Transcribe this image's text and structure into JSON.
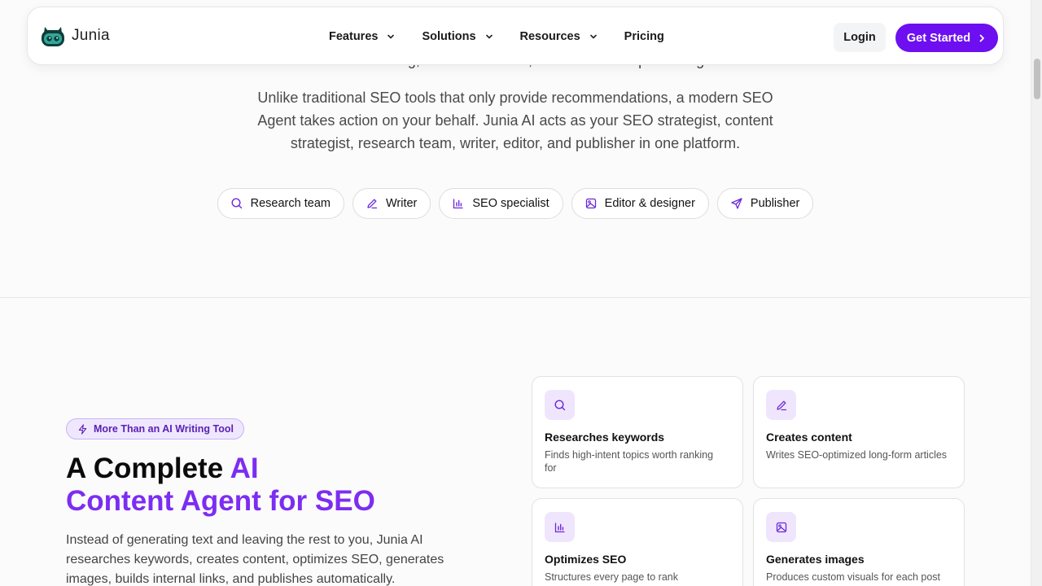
{
  "header": {
    "brand": "Junia",
    "nav": [
      {
        "label": "Features",
        "has_dropdown": true
      },
      {
        "label": "Solutions",
        "has_dropdown": true
      },
      {
        "label": "Resources",
        "has_dropdown": true
      },
      {
        "label": "Pricing",
        "has_dropdown": false
      }
    ],
    "login_label": "Login",
    "cta_label": "Get Started"
  },
  "top_fragment": {
    "line1": "",
    "line2": "internal linking, content creation, and automated publishing."
  },
  "intro": {
    "text": "Unlike traditional SEO tools that only provide recommendations, a modern SEO Agent takes action on your behalf. Junia AI acts as your SEO strategist, content strategist, research team, writer, editor, and publisher in one platform."
  },
  "roles": [
    {
      "label": "Research team",
      "icon": "search-icon"
    },
    {
      "label": "Writer",
      "icon": "pen-icon"
    },
    {
      "label": "SEO specialist",
      "icon": "bar-chart-icon"
    },
    {
      "label": "Editor & designer",
      "icon": "image-icon"
    },
    {
      "label": "Publisher",
      "icon": "send-icon"
    }
  ],
  "section": {
    "badge": "More Than an AI Writing Tool",
    "headline_plain": "A Complete ",
    "headline_accent_1": "AI",
    "headline_accent_2": "Content Agent for SEO",
    "description": "Instead of generating text and leaving the rest to you, Junia AI researches keywords, creates content, optimizes SEO, generates images, builds internal links, and publishes automatically."
  },
  "features": [
    {
      "title": "Researches keywords",
      "desc": "Finds high-intent topics worth ranking for",
      "icon": "search-icon"
    },
    {
      "title": "Creates content",
      "desc": "Writes SEO-optimized long-form articles",
      "icon": "pen-icon"
    },
    {
      "title": "Optimizes SEO",
      "desc": "Structures every page to rank",
      "icon": "bar-chart-icon"
    },
    {
      "title": "Generates images",
      "desc": "Produces custom visuals for each post",
      "icon": "image-icon"
    }
  ],
  "colors": {
    "accent": "#6d0ff0",
    "accent_text": "#7c2df2",
    "badge_bg": "#efe7fd"
  }
}
